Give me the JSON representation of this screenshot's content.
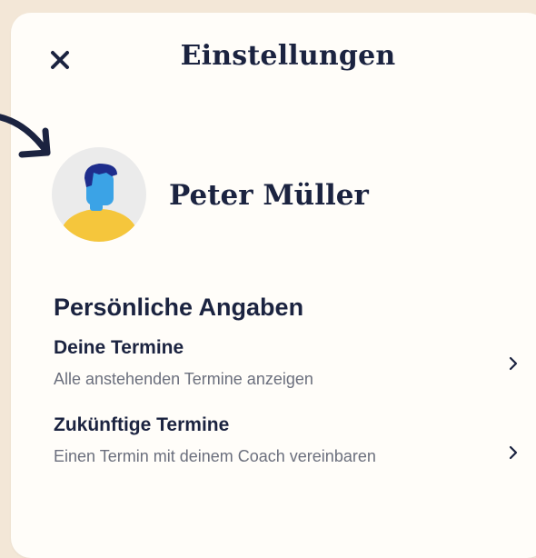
{
  "header": {
    "title": "Einstellungen",
    "close_icon": "close-icon"
  },
  "profile": {
    "name": "Peter Müller",
    "avatar_icon": "user-avatar-icon"
  },
  "section": {
    "title": "Persönliche Angaben",
    "items": [
      {
        "title": "Deine Termine",
        "subtitle": "Alle anstehenden Termine anzeigen",
        "icon": "chevron-right-icon"
      },
      {
        "title": "Zukünftige Termine",
        "subtitle": "Einen Termin mit deinem Coach vereinbaren",
        "icon": "chevron-right-icon"
      }
    ]
  },
  "colors": {
    "background": "#f3e7d7",
    "card": "#fffdf9",
    "text_dark": "#1b2340",
    "text_muted": "#6b6f7d",
    "avatar_bg": "#ebebeb",
    "avatar_shirt": "#f5c63c",
    "avatar_face": "#3ba3e6",
    "avatar_hair": "#1e2d8c"
  }
}
